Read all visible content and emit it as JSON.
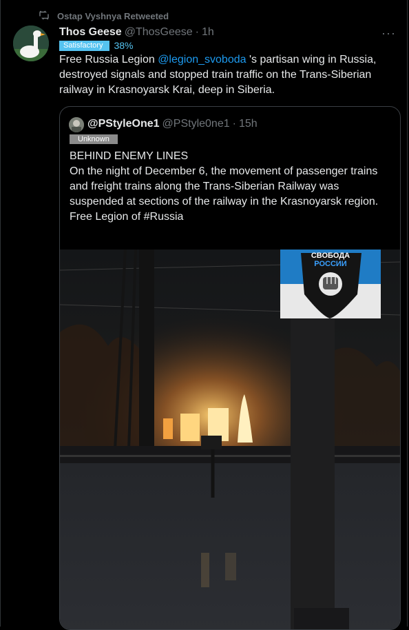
{
  "retweet": {
    "label": "Ostap Vyshnya Retweeted",
    "icon": "retweet-icon"
  },
  "tweet": {
    "display_name": "Thos Geese",
    "handle": "@ThosGeese",
    "separator": "·",
    "time": "1h",
    "more": "···",
    "badge": {
      "label": "Satisfactory",
      "percent": "38%",
      "color": "#55c3f0"
    },
    "text_before": "Free Russia Legion ",
    "mention": "@legion_svoboda",
    "text_after": " 's partisan wing in Russia, destroyed signals and stopped train traffic on the Trans-Siberian railway in Krasnoyarsk Krai, deep in Siberia."
  },
  "quote": {
    "display_name": "@PStyleOne1",
    "handle": "@PStyle0ne1",
    "separator": "·",
    "time": "15h",
    "badge": "Unknown",
    "lines": [
      "BEHIND ENEMY LINES",
      "On the night of December 6, the movement of passenger trains and freight trains along the Trans-Siberian Railway was suspended at sections of the railway in the Krasnoyarsk region.",
      "Free Legion of #Russia"
    ],
    "media": {
      "logo_line1": "СВОБОДА",
      "logo_line2": "РОССИИ"
    }
  },
  "colors": {
    "background": "#000000",
    "text": "#e7e9ea",
    "muted": "#71767b",
    "link": "#1d9bf0"
  }
}
